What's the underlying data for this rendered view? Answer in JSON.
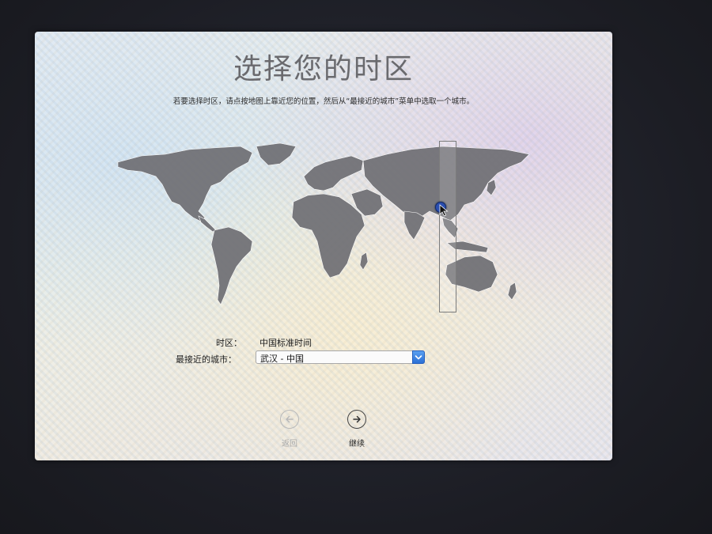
{
  "screen": {
    "title": "选择您的时区",
    "subtitle": "若要选择时区，请点按地图上靠近您的位置，然后从“最接近的城市”菜单中选取一个城市。"
  },
  "form": {
    "timezone_label": "时区：",
    "timezone_value": "中国标准时间",
    "city_label": "最接近的城市：",
    "city_value": "武汉 - 中国"
  },
  "nav": {
    "back_label": "返回",
    "continue_label": "继续"
  },
  "icons": {
    "location_pin": "location-pin-icon",
    "select_arrow": "chevron-down-icon",
    "back": "arrow-left-circle-icon",
    "continue": "arrow-right-circle-icon"
  },
  "colors": {
    "accent": "#2a6fd6",
    "pin": "#2b4fb0",
    "title": "#6a6a6e"
  }
}
